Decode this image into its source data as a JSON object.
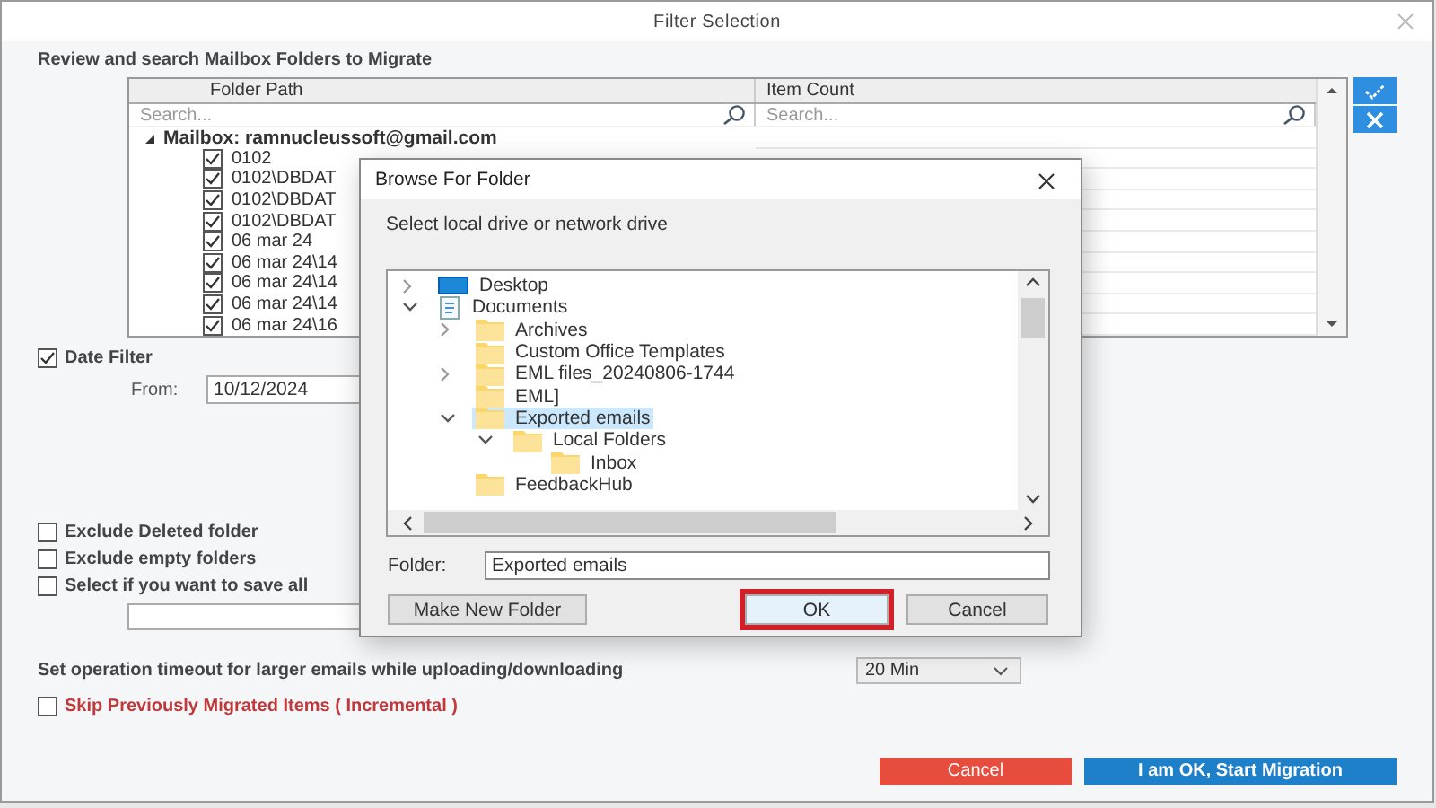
{
  "window": {
    "title": "Filter Selection"
  },
  "heading": "Review and search Mailbox Folders to Migrate",
  "folder_table": {
    "columns": [
      "Folder Path",
      "Item Count"
    ],
    "search_placeholders": [
      "Search...",
      "Search..."
    ],
    "root": {
      "label": "Mailbox: ramnucleussoft@gmail.com",
      "expanded": true,
      "children": [
        {
          "label": "0102",
          "checked": true
        },
        {
          "label": "0102\\DBDAT",
          "checked": true
        },
        {
          "label": "0102\\DBDAT",
          "checked": true
        },
        {
          "label": "0102\\DBDAT",
          "checked": true
        },
        {
          "label": "06 mar 24",
          "checked": true
        },
        {
          "label": "06 mar 24\\14",
          "checked": true
        },
        {
          "label": "06 mar 24\\14",
          "checked": true
        },
        {
          "label": "06 mar 24\\14",
          "checked": true
        },
        {
          "label": "06 mar 24\\16",
          "checked": true
        }
      ]
    }
  },
  "date_filter": {
    "label": "Date Filter",
    "checked": true,
    "from_label": "From:",
    "from_value": "10/12/2024"
  },
  "options": [
    {
      "label": "Exclude Deleted folder",
      "checked": false
    },
    {
      "label": "Exclude empty folders",
      "checked": false
    },
    {
      "label": "Select if you want to save all",
      "checked": false
    }
  ],
  "timeout": {
    "label": "Set operation timeout for larger emails while uploading/downloading",
    "value": "20 Min"
  },
  "incremental": {
    "label": "Skip Previously Migrated Items ( Incremental )",
    "checked": false
  },
  "buttons": [
    {
      "label": "Cancel",
      "kind": "danger"
    },
    {
      "label": "I am OK, Start Migration",
      "kind": "primary"
    }
  ],
  "browse_dialog": {
    "title": "Browse For Folder",
    "instruction": "Select local drive or network drive",
    "tree": [
      {
        "label": "Desktop",
        "kind": "desktop",
        "expanded": false,
        "selected": false
      },
      {
        "label": "Documents",
        "kind": "documents",
        "expanded": true,
        "selected": false,
        "children": [
          {
            "label": "Archives",
            "kind": "folder",
            "expanded": false,
            "selected": false
          },
          {
            "label": "Custom Office Templates",
            "kind": "folder",
            "selected": false
          },
          {
            "label": "EML files_20240806-1744",
            "kind": "folder",
            "expanded": false,
            "selected": false
          },
          {
            "label": "EML]",
            "kind": "folder",
            "selected": false
          },
          {
            "label": "Exported emails",
            "kind": "folder",
            "expanded": true,
            "selected": true,
            "children": [
              {
                "label": "Local Folders",
                "kind": "folder",
                "expanded": true,
                "selected": false,
                "children": [
                  {
                    "label": "Inbox",
                    "kind": "folder",
                    "selected": false
                  }
                ]
              }
            ]
          },
          {
            "label": "FeedbackHub",
            "kind": "folder",
            "selected": false
          }
        ]
      }
    ],
    "folder_label": "Folder:",
    "folder_value": "Exported emails",
    "buttons": [
      {
        "label": "Make New Folder",
        "highlighted": false
      },
      {
        "label": "OK",
        "highlighted": true
      },
      {
        "label": "Cancel",
        "highlighted": false
      }
    ]
  }
}
